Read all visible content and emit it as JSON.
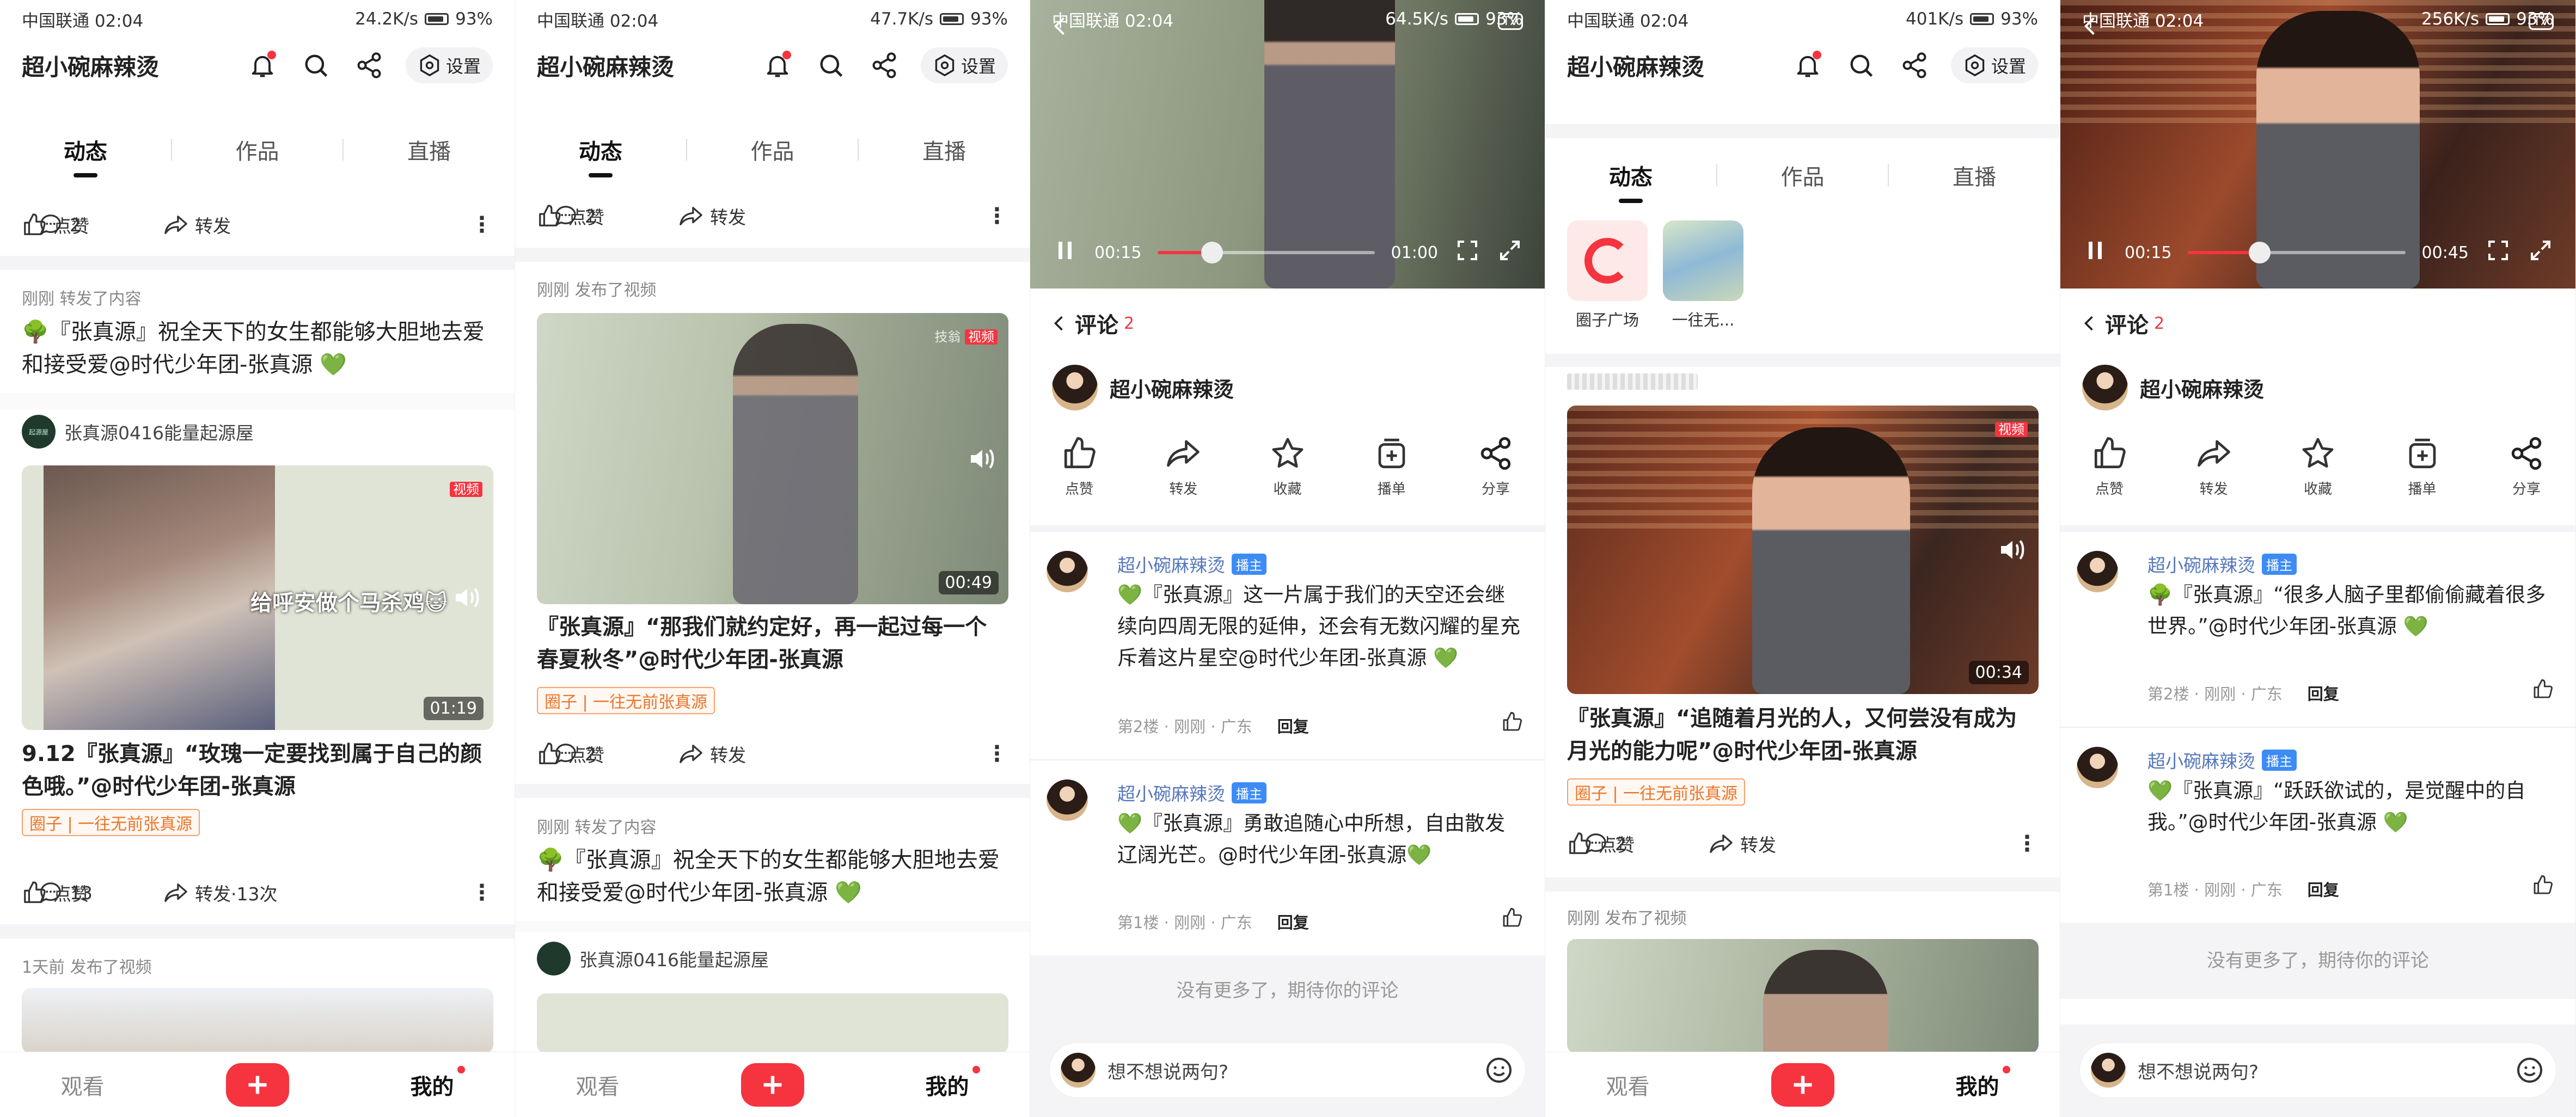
{
  "status": {
    "carrier": "中国联通",
    "time": "02:04",
    "battery": "93%",
    "speeds": [
      "24.2K/s",
      "47.7K/s",
      "64.5K/s",
      "401K/s",
      "256K/s"
    ]
  },
  "profile": {
    "title": "超小碗麻辣烫",
    "settings_label": "设置",
    "tabs": [
      "动态",
      "作品",
      "直播"
    ]
  },
  "bottom_nav": {
    "watch": "观看",
    "mine": "我的"
  },
  "actions": {
    "like": "点赞",
    "share": "转发"
  },
  "panel1": {
    "top_actions": {
      "comments": "2"
    },
    "repost": {
      "meta": "刚刚 转发了内容",
      "text": "🌳『张真源』祝全天下的女生都能够大胆地去爱和接受爱@时代少年团-张真源 💚"
    },
    "source": {
      "name": "张真源0416能量起源屋",
      "avatar_text": "起源屋"
    },
    "video": {
      "overlay": "给呼安做个马杀鸡😺",
      "duration": "01:19",
      "tag": "视频",
      "text": "9.12『张真源』“玫瑰一定要找到属于自己的颜色哦。”@时代少年团-张真源",
      "circle": "圈子 | 一往无前张真源",
      "comments": "13",
      "shares": "转发·13次"
    },
    "next_meta": "1天前 发布了视频"
  },
  "panel2": {
    "top_actions": {
      "comments": "2"
    },
    "post": {
      "meta": "刚刚 发布了视频",
      "tag_prefix": "技翁",
      "tag": "视频",
      "duration": "00:49",
      "text": "『张真源』“那我们就约定好，再一起过每一个春夏秋冬”@时代少年团-张真源",
      "circle": "圈子 | 一往无前张真源",
      "comments": "2"
    },
    "repost": {
      "meta": "刚刚 转发了内容",
      "text": "🌳『张真源』祝全天下的女生都能够大胆地去爱和接受爱@时代少年团-张真源 💚"
    },
    "source": {
      "name": "张真源0416能量起源屋"
    }
  },
  "panel3": {
    "video": {
      "current": "00:15",
      "total": "01:00",
      "progress": 0.25
    },
    "comments_title": "评论",
    "comments_count": "2",
    "author": "超小碗麻辣烫",
    "icons": [
      "点赞",
      "转发",
      "收藏",
      "播单",
      "分享"
    ],
    "comments": [
      {
        "name": "超小碗麻辣烫",
        "badge": "播主",
        "text": "💚『张真源』这一片属于我们的天空还会继续向四周无限的延伸，还会有无数闪耀的星充斥着这片星空@时代少年团-张真源 💚",
        "floor": "第2楼 · 刚刚 · 广东",
        "reply": "回复"
      },
      {
        "name": "超小碗麻辣烫",
        "badge": "播主",
        "text": "💚『张真源』勇敢追随心中所想，自由散发辽阔光芒。@时代少年团-张真源💚",
        "floor": "第1楼 · 刚刚 · 广东",
        "reply": "回复"
      }
    ],
    "no_more": "没有更多了，期待你的评论",
    "input_placeholder": "想不想说两句?"
  },
  "panel4": {
    "circles": [
      {
        "label": "圈子广场"
      },
      {
        "label": "一往无..."
      }
    ],
    "blurred_meta": "",
    "post": {
      "tag": "视频",
      "duration": "00:34",
      "text": "『张真源』“追随着月光的人，又何尝没有成为月光的能力呢”@时代少年团-张真源",
      "circle": "圈子 | 一往无前张真源",
      "comments": "2"
    },
    "next_meta": "刚刚 发布了视频"
  },
  "panel5": {
    "video": {
      "current": "00:15",
      "total": "00:45",
      "progress": 0.33
    },
    "comments_title": "评论",
    "comments_count": "2",
    "author": "超小碗麻辣烫",
    "icons": [
      "点赞",
      "转发",
      "收藏",
      "播单",
      "分享"
    ],
    "comments": [
      {
        "name": "超小碗麻辣烫",
        "badge": "播主",
        "text": "🌳『张真源』“很多人脑子里都偷偷藏着很多世界。”@时代少年团-张真源 💚",
        "floor": "第2楼 · 刚刚 · 广东",
        "reply": "回复"
      },
      {
        "name": "超小碗麻辣烫",
        "badge": "播主",
        "text": "💚『张真源』“跃跃欲试的，是觉醒中的自我。”@时代少年团-张真源 💚",
        "floor": "第1楼 · 刚刚 · 广东",
        "reply": "回复"
      }
    ],
    "no_more": "没有更多了，期待你的评论",
    "input_placeholder": "想不想说两句?"
  },
  "colors": {
    "accent": "#f5343f",
    "circle_orange": "#e8762c",
    "host_blue": "#3d8cf5",
    "name_blue": "#5577bb"
  }
}
